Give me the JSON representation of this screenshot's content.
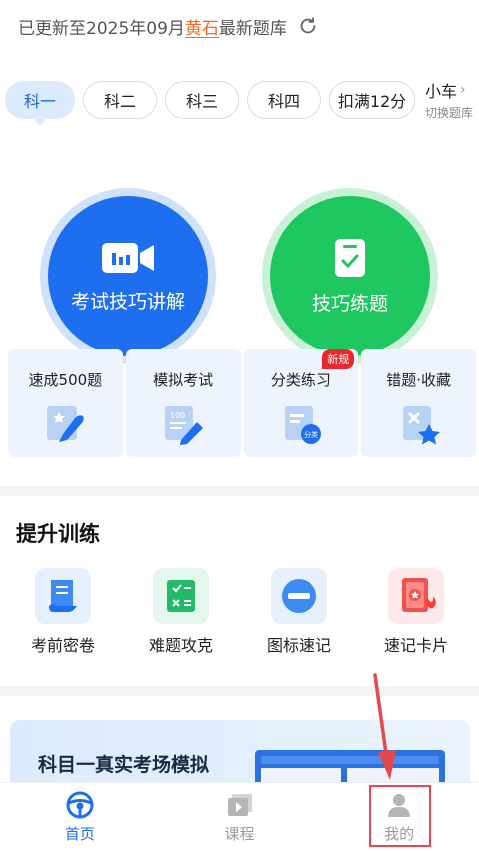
{
  "header": {
    "update_prefix": "已更新至2025年09月",
    "update_highlight": "黄石",
    "update_suffix": "最新题库"
  },
  "tabs": [
    {
      "label": "科一",
      "active": true
    },
    {
      "label": "科二",
      "active": false
    },
    {
      "label": "科三",
      "active": false
    },
    {
      "label": "科四",
      "active": false
    },
    {
      "label": "扣满12分",
      "active": false
    }
  ],
  "car_switch": {
    "label": "小车",
    "sub": "切换题库"
  },
  "main_actions": {
    "exam_tips": "考试技巧讲解",
    "practice": "技巧练题"
  },
  "cards": [
    {
      "label": "速成500题",
      "icon": "rocket-icon"
    },
    {
      "label": "模拟考试",
      "icon": "exam-pen-icon"
    },
    {
      "label": "分类练习",
      "icon": "category-icon",
      "badge": "新规"
    },
    {
      "label": "错题·收藏",
      "icon": "wrong-star-icon"
    }
  ],
  "training": {
    "title": "提升训练",
    "items": [
      {
        "label": "考前密卷",
        "icon": "scroll-icon"
      },
      {
        "label": "难题攻克",
        "icon": "calculator-icon"
      },
      {
        "label": "图标速记",
        "icon": "no-entry-sign-icon"
      },
      {
        "label": "速记卡片",
        "icon": "flash-card-icon"
      }
    ]
  },
  "banner": {
    "title": "科目一真实考场模拟"
  },
  "bottom_nav": [
    {
      "label": "首页",
      "active": true,
      "icon": "steering-wheel-icon"
    },
    {
      "label": "课程",
      "active": false,
      "icon": "video-play-icon"
    },
    {
      "label": "我的",
      "active": false,
      "icon": "user-icon"
    }
  ],
  "colors": {
    "primary": "#1e6ff0",
    "green": "#1fc760",
    "highlight": "#f26a1b",
    "annotation": "#e5484d"
  }
}
